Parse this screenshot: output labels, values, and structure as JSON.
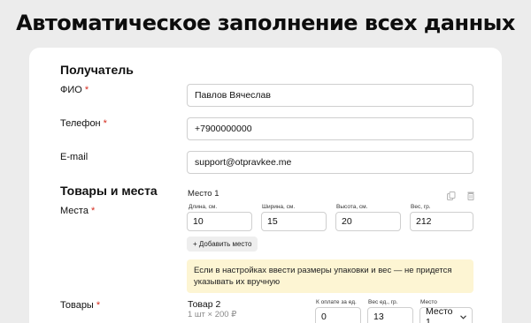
{
  "headline": "Автоматическое заполнение всех данных",
  "recipient": {
    "title": "Получатель",
    "name": {
      "label": "ФИО",
      "required_mark": "*",
      "value": "Павлов Вячеслав"
    },
    "phone": {
      "label": "Телефон",
      "required_mark": "*",
      "value": "+7900000000"
    },
    "email": {
      "label": "E-mail",
      "value": "support@otpravkee.me"
    }
  },
  "goods_places": {
    "title": "Товары и места",
    "places": {
      "label": "Места",
      "required_mark": "*",
      "place_title": "Место 1",
      "length": {
        "label": "Длина, см.",
        "value": "10"
      },
      "width": {
        "label": "Ширина, см.",
        "value": "15"
      },
      "height": {
        "label": "Высота, см.",
        "value": "20"
      },
      "weight": {
        "label": "Вес, гр.",
        "value": "212"
      },
      "add_place_label": "+ Добавить место",
      "copy_icon": "copy-icon",
      "delete_icon": "trash-icon"
    },
    "note": "Если в настройках ввести размеры упаковки и вес — не придется указывать их вручную"
  },
  "goods": {
    "label": "Товары",
    "required_mark": "*",
    "item_name": "Товар 2",
    "item_qty_price": "1 шт × 200 ₽",
    "to_pay": {
      "label": "К оплате за ед.",
      "value": "0"
    },
    "unit_weight": {
      "label": "Вес ед., гр.",
      "value": "13"
    },
    "place": {
      "label": "Место",
      "value": "Место 1"
    }
  },
  "colors": {
    "required": "#d52b1e",
    "note_bg": "#fdf5d3",
    "page_bg": "#ececec"
  }
}
